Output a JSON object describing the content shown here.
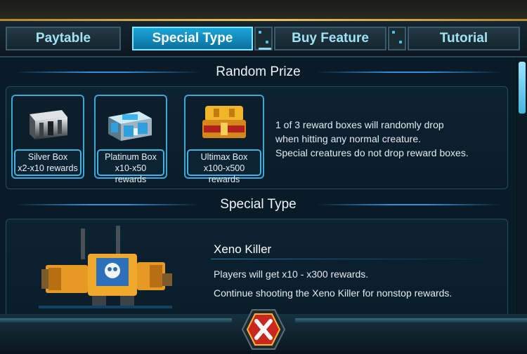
{
  "tabs": [
    {
      "label": "Paytable"
    },
    {
      "label": "Special Type"
    },
    {
      "label": "Buy Feature"
    },
    {
      "label": "Tutorial"
    }
  ],
  "random_prize": {
    "title": "Random Prize",
    "boxes": [
      {
        "name": "Silver Box",
        "rewards": "x2-x10 rewards"
      },
      {
        "name": "Platinum Box",
        "rewards": "x10-x50 rewards"
      },
      {
        "name": "Ultimax Box",
        "rewards": "x100-x500 rewards"
      }
    ],
    "description": [
      "1 of 3 reward boxes will randomly drop",
      "when hitting any normal creature.",
      "Special creatures do not drop reward boxes."
    ]
  },
  "special_type": {
    "title": "Special Type",
    "creature": {
      "name": "Xeno Killer",
      "lines": [
        "Players will get x10 - x300 rewards.",
        "Continue shooting the Xeno Killer for nonstop rewards."
      ]
    }
  },
  "colors": {
    "accent": "#36c8ff",
    "tab_text": "#9fe3f4",
    "active_tab": "#1aa6d8",
    "close_button": "#c8281e"
  }
}
